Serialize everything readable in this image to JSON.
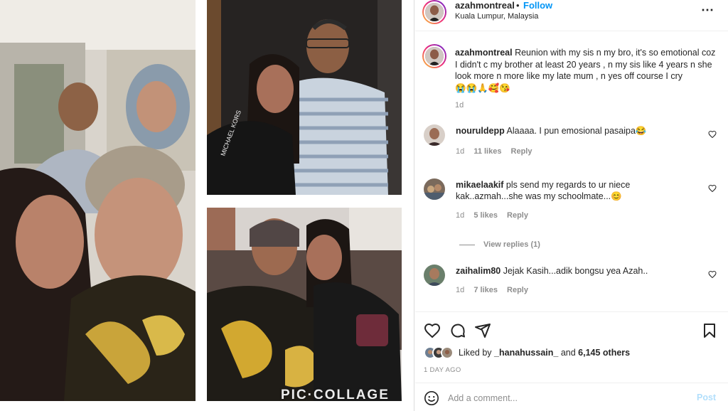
{
  "collage": {
    "watermark": "PIC·COLLAGE"
  },
  "header": {
    "username": "azahmontreal",
    "separator": "•",
    "follow_label": "Follow",
    "location": "Kuala Lumpur, Malaysia",
    "more_icon": "⋯"
  },
  "caption": {
    "username": "azahmontreal",
    "text": "Reunion with my sis n my bro, it's so emotional coz I didn't c my brother at least 20 years , n my sis like 4 years n she look more n more like my late mum , n yes off course I cry",
    "emojis": "😭😭🙏🥰😘",
    "age": "1d"
  },
  "comments": [
    {
      "username": "nouruldepp",
      "text": "Alaaaa. I pun emosional pasaipa😂",
      "age": "1d",
      "likes": "11 likes",
      "reply": "Reply"
    },
    {
      "username": "mikaelaakif",
      "text": "pls send my regards to ur niece kak..azmah...she was my schoolmate...😊",
      "age": "1d",
      "likes": "5 likes",
      "reply": "Reply"
    },
    {
      "username": "zaihalim80",
      "text": "Jejak Kasih...adik bongsu yea Azah..",
      "age": "1d",
      "likes": "7 likes",
      "reply": "Reply"
    }
  ],
  "view_replies": "View replies (1)",
  "likes": {
    "prefix": "Liked by ",
    "user": "_hanahussain_",
    "middle": " and ",
    "count": "6,145 others"
  },
  "timestamp": "1 DAY AGO",
  "add_comment": {
    "placeholder": "Add a comment...",
    "post_label": "Post"
  },
  "icons": {
    "more": "more-options-icon",
    "like": "heart-icon",
    "comment": "comment-icon",
    "share": "send-icon",
    "save": "bookmark-icon",
    "emoji": "emoji-icon"
  },
  "colors": {
    "accent": "#0095f6",
    "post_disabled": "#b2dffc",
    "muted": "#8e8e8e",
    "text": "#262626"
  }
}
